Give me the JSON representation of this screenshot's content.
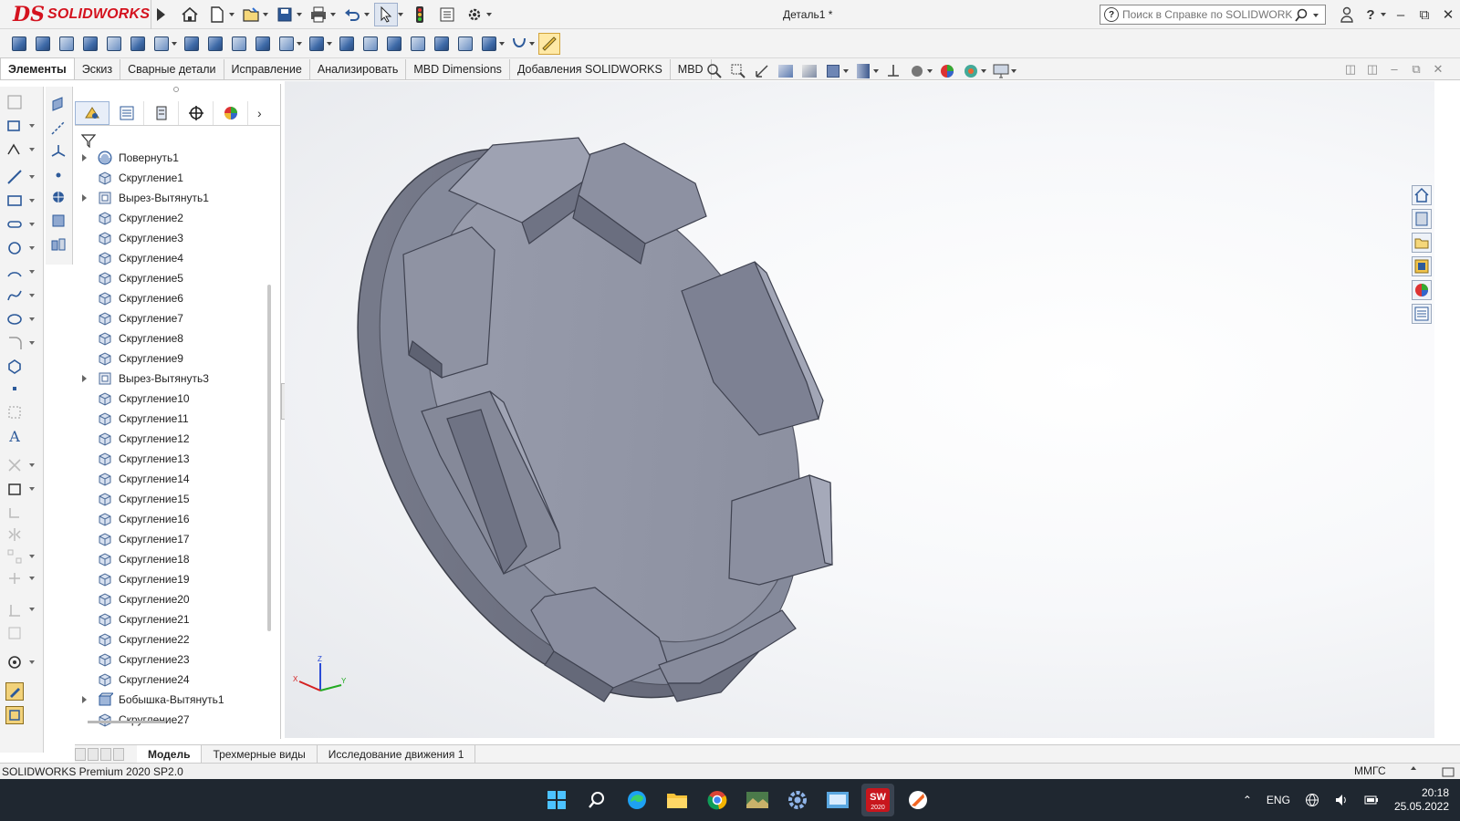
{
  "app": {
    "brand_prefix": "DS",
    "brand": "SOLIDWORKS",
    "document_title": "Деталь1 *",
    "help_search_placeholder": "Поиск в Справке по SOLIDWORKS"
  },
  "command_tabs": [
    {
      "label": "Элементы",
      "active": true
    },
    {
      "label": "Эскиз",
      "active": false
    },
    {
      "label": "Сварные детали",
      "active": false
    },
    {
      "label": "Исправление",
      "active": false
    },
    {
      "label": "Анализировать",
      "active": false
    },
    {
      "label": "MBD Dimensions",
      "active": false
    },
    {
      "label": "Добавления SOLIDWORKS",
      "active": false
    },
    {
      "label": "MBD",
      "active": false
    }
  ],
  "feature_tree": [
    {
      "label": "Повернуть1",
      "expandable": true,
      "icon": "revolve-icon"
    },
    {
      "label": "Скругление1",
      "expandable": false,
      "icon": "fillet-icon"
    },
    {
      "label": "Вырез-Вытянуть1",
      "expandable": true,
      "icon": "cut-extrude-icon"
    },
    {
      "label": "Скругление2",
      "expandable": false,
      "icon": "fillet-icon"
    },
    {
      "label": "Скругление3",
      "expandable": false,
      "icon": "fillet-icon"
    },
    {
      "label": "Скругление4",
      "expandable": false,
      "icon": "fillet-icon"
    },
    {
      "label": "Скругление5",
      "expandable": false,
      "icon": "fillet-icon"
    },
    {
      "label": "Скругление6",
      "expandable": false,
      "icon": "fillet-icon"
    },
    {
      "label": "Скругление7",
      "expandable": false,
      "icon": "fillet-icon"
    },
    {
      "label": "Скругление8",
      "expandable": false,
      "icon": "fillet-icon"
    },
    {
      "label": "Скругление9",
      "expandable": false,
      "icon": "fillet-icon"
    },
    {
      "label": "Вырез-Вытянуть3",
      "expandable": true,
      "icon": "cut-extrude-icon"
    },
    {
      "label": "Скругление10",
      "expandable": false,
      "icon": "fillet-icon"
    },
    {
      "label": "Скругление11",
      "expandable": false,
      "icon": "fillet-icon"
    },
    {
      "label": "Скругление12",
      "expandable": false,
      "icon": "fillet-icon"
    },
    {
      "label": "Скругление13",
      "expandable": false,
      "icon": "fillet-icon"
    },
    {
      "label": "Скругление14",
      "expandable": false,
      "icon": "fillet-icon"
    },
    {
      "label": "Скругление15",
      "expandable": false,
      "icon": "fillet-icon"
    },
    {
      "label": "Скругление16",
      "expandable": false,
      "icon": "fillet-icon"
    },
    {
      "label": "Скругление17",
      "expandable": false,
      "icon": "fillet-icon"
    },
    {
      "label": "Скругление18",
      "expandable": false,
      "icon": "fillet-icon"
    },
    {
      "label": "Скругление19",
      "expandable": false,
      "icon": "fillet-icon"
    },
    {
      "label": "Скругление20",
      "expandable": false,
      "icon": "fillet-icon"
    },
    {
      "label": "Скругление21",
      "expandable": false,
      "icon": "fillet-icon"
    },
    {
      "label": "Скругление22",
      "expandable": false,
      "icon": "fillet-icon"
    },
    {
      "label": "Скругление23",
      "expandable": false,
      "icon": "fillet-icon"
    },
    {
      "label": "Скругление24",
      "expandable": false,
      "icon": "fillet-icon"
    },
    {
      "label": "Бобышка-Вытянуть1",
      "expandable": true,
      "icon": "boss-extrude-icon"
    },
    {
      "label": "Скругление27",
      "expandable": false,
      "icon": "fillet-icon"
    }
  ],
  "bottom_tabs": [
    {
      "label": "Модель",
      "active": true
    },
    {
      "label": "Трехмерные виды",
      "active": false
    },
    {
      "label": "Исследование движения 1",
      "active": false
    }
  ],
  "status": {
    "product": "SOLIDWORKS Premium 2020 SP2.0",
    "units": "ММГС"
  },
  "triad": {
    "x": "X",
    "y": "Y",
    "z": "Z"
  },
  "taskbar": {
    "apps": [
      "windows-start-icon",
      "search-icon",
      "edge-icon",
      "file-explorer-icon",
      "chrome-icon",
      "photos-icon",
      "settings-icon",
      "control-panel-icon",
      "solidworks-2020-icon",
      "app-orange-icon"
    ],
    "solidworks_badge": "SW",
    "solidworks_year": "2020",
    "language": "ENG",
    "time": "20:18",
    "date": "25.05.2022"
  },
  "colors": {
    "brand_red": "#d4121e",
    "part_face": "#8f93a3",
    "part_dark": "#6c7080",
    "taskbar_bg": "#1f2730"
  }
}
